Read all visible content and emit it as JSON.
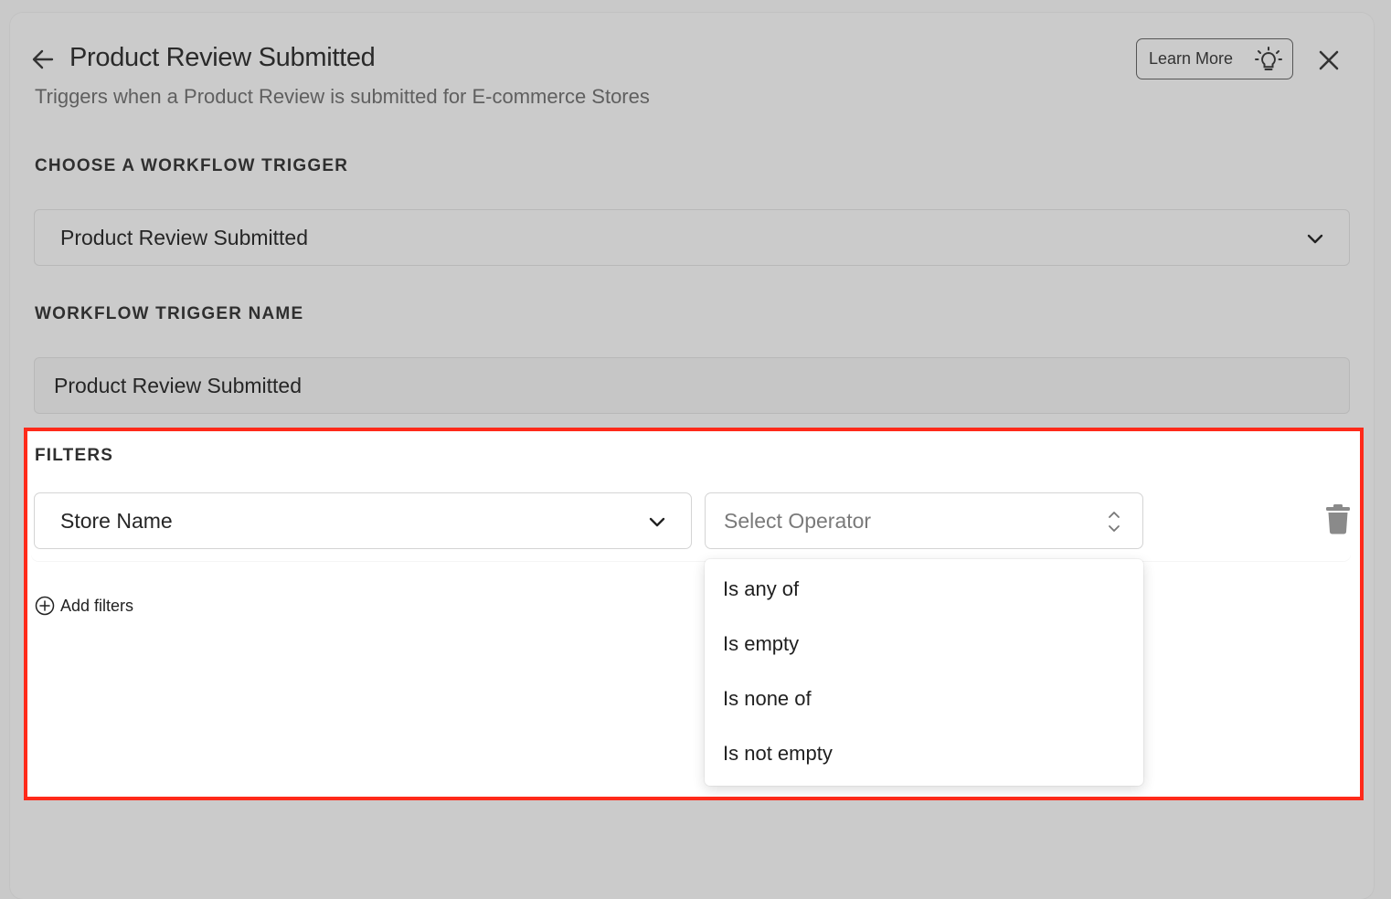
{
  "header": {
    "title": "Product Review Submitted",
    "subtitle": "Triggers when a Product Review is submitted for E-commerce Stores",
    "learn_more_label": "Learn More",
    "icons": [
      "back-arrow-icon",
      "lightbulb-icon",
      "close-icon"
    ]
  },
  "trigger": {
    "section_label": "CHOOSE A WORKFLOW TRIGGER",
    "selected_value": "Product Review Submitted"
  },
  "trigger_name": {
    "section_label": "WORKFLOW TRIGGER NAME",
    "value": "Product Review Submitted"
  },
  "filters": {
    "section_label": "FILTERS",
    "field_value": "Store Name",
    "operator_placeholder": "Select Operator",
    "add_filters_label": "Add filters",
    "operator_options": [
      "Is any of",
      "Is empty",
      "Is none of",
      "Is not empty"
    ]
  },
  "colors": {
    "highlight_border": "#ff2a1a",
    "overlay_background": "#cbcbcb"
  }
}
